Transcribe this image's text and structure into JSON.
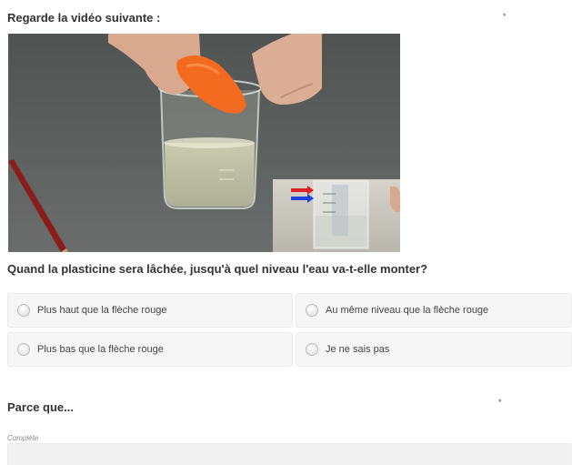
{
  "question1": {
    "title": "Regarde la vidéo suivante :",
    "required_mark": "*"
  },
  "question2": {
    "title": "Quand la plasticine sera lâchée, jusqu'à quel niveau l'eau va-t-elle monter?",
    "choices": [
      "Plus haut que la flèche rouge",
      "Au même niveau que la flèche rouge",
      "Plus bas que la flèche rouge",
      "Je ne sais pas"
    ]
  },
  "question3": {
    "title": "Parce que...",
    "required_mark": "*",
    "hint": "Complète"
  },
  "colors": {
    "radio_border": "#bdbdbd",
    "choice_bg": "#f6f6f6",
    "arrow_red": "#e02020",
    "arrow_blue": "#2040e0"
  }
}
